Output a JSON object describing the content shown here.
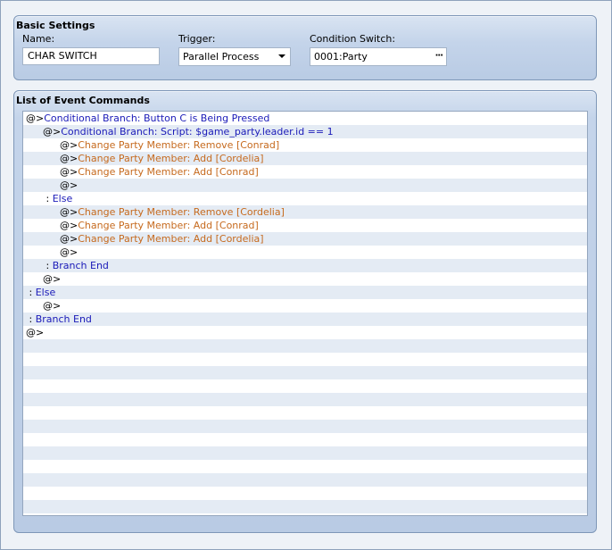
{
  "basic_settings": {
    "title": "Basic Settings",
    "name_label": "Name:",
    "name_value": "CHAR SWITCH",
    "trigger_label": "Trigger:",
    "trigger_value": "Parallel Process",
    "condition_label": "Condition Switch:",
    "condition_value": "0001:Party",
    "browse_glyph": "···"
  },
  "commands": {
    "title": "List of Event Commands",
    "rows": [
      {
        "indent": 0,
        "marker": "@>",
        "text": "Conditional Branch: Button C is Being Pressed",
        "color": "blue"
      },
      {
        "indent": 1,
        "marker": "@>",
        "text": "Conditional Branch: Script: $game_party.leader.id == 1",
        "color": "blue"
      },
      {
        "indent": 2,
        "marker": "@>",
        "text": "Change Party Member: Remove [Conrad]",
        "color": "orange"
      },
      {
        "indent": 2,
        "marker": "@>",
        "text": "Change Party Member: Add [Cordelia]",
        "color": "orange"
      },
      {
        "indent": 2,
        "marker": "@>",
        "text": "Change Party Member: Add [Conrad]",
        "color": "orange"
      },
      {
        "indent": 2,
        "marker": "@>",
        "text": "",
        "color": "blue"
      },
      {
        "indent": 1,
        "marker": " : ",
        "text": "Else",
        "color": "blue"
      },
      {
        "indent": 2,
        "marker": "@>",
        "text": "Change Party Member: Remove [Cordelia]",
        "color": "orange"
      },
      {
        "indent": 2,
        "marker": "@>",
        "text": "Change Party Member: Add [Conrad]",
        "color": "orange"
      },
      {
        "indent": 2,
        "marker": "@>",
        "text": "Change Party Member: Add [Cordelia]",
        "color": "orange"
      },
      {
        "indent": 2,
        "marker": "@>",
        "text": "",
        "color": "blue"
      },
      {
        "indent": 1,
        "marker": " : ",
        "text": "Branch End",
        "color": "blue"
      },
      {
        "indent": 1,
        "marker": "@>",
        "text": "",
        "color": "blue"
      },
      {
        "indent": 0,
        "marker": " : ",
        "text": "Else",
        "color": "blue"
      },
      {
        "indent": 1,
        "marker": "@>",
        "text": "",
        "color": "blue"
      },
      {
        "indent": 0,
        "marker": " : ",
        "text": "Branch End",
        "color": "blue"
      },
      {
        "indent": 0,
        "marker": "@>",
        "text": "",
        "color": "blue"
      }
    ],
    "empty_rows": 13
  },
  "colors": {
    "command_blue": "#1a1ab8",
    "command_orange": "#c66a1e",
    "row_stripe": "#e4ebf4",
    "group_border": "#7e97b8"
  }
}
